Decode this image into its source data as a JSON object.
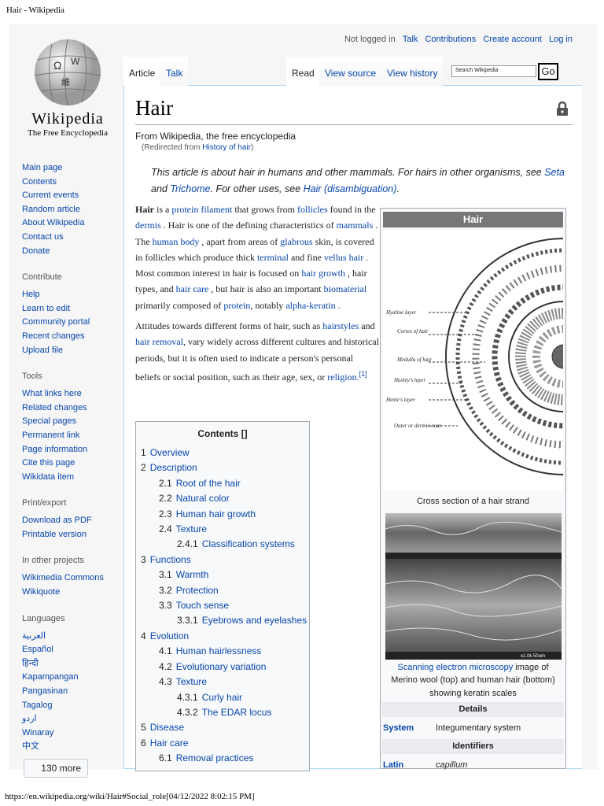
{
  "browser": {
    "doc_title": "Hair - Wikipedia",
    "footer_url": "https://en.wikipedia.org/wiki/Hair#Social_role[04/12/2022 8:02:15 PM]"
  },
  "logo": {
    "wordmark": "Wikipedia",
    "tagline": "The Free Encyclopedia"
  },
  "personal": {
    "not_logged": "Not logged in",
    "talk": "Talk",
    "contributions": "Contributions",
    "create": "Create account",
    "login": "Log in"
  },
  "tabs": {
    "article": "Article",
    "talk": "Talk",
    "read": "Read",
    "view_source": "View source",
    "history": "View history"
  },
  "search": {
    "placeholder": "Search Wikipedia",
    "go": "Go"
  },
  "sidebar": [
    {
      "heading": null,
      "items": [
        "Main page",
        "Contents",
        "Current events",
        "Random article",
        "About Wikipedia",
        "Contact us",
        "Donate"
      ]
    },
    {
      "heading": "Contribute",
      "items": [
        "Help",
        "Learn to edit",
        "Community portal",
        "Recent changes",
        "Upload file"
      ]
    },
    {
      "heading": "Tools",
      "items": [
        "What links here",
        "Related changes",
        "Special pages",
        "Permanent link",
        "Page information",
        "Cite this page",
        "Wikidata item"
      ]
    },
    {
      "heading": "Print/export",
      "items": [
        "Download as PDF",
        "Printable version"
      ]
    },
    {
      "heading": "In other projects",
      "items": [
        "Wikimedia Commons",
        "Wikiquote"
      ]
    },
    {
      "heading": "Languages",
      "items": [
        "العربية",
        "Español",
        "हिन्दी",
        "Kapampangan",
        "Pangasinan",
        "Tagalog",
        "اردو",
        "Winaray",
        "中文"
      ]
    }
  ],
  "languages_more": "130 more",
  "article": {
    "title": "Hair",
    "from": "From Wikipedia, the free encyclopedia",
    "redirected_prefix": "(Redirected from ",
    "redirected_link": "History of hair",
    "redirected_suffix": ")",
    "hatnote": [
      [
        "t",
        "This article is about hair in humans and other mammals. For hairs in other organisms, see "
      ],
      [
        "l",
        "Seta"
      ],
      [
        "t",
        " and "
      ],
      [
        "l",
        "Trichome"
      ],
      [
        "t",
        ". For other uses, see "
      ],
      [
        "l",
        "Hair (disambiguation)"
      ],
      [
        "t",
        "."
      ]
    ],
    "paragraphs": [
      [
        [
          "b",
          "Hair"
        ],
        [
          "t",
          " is a  "
        ],
        [
          "l",
          "protein filament"
        ],
        [
          "t",
          " that grows from "
        ],
        [
          "l",
          "follicles"
        ],
        [
          "t",
          " found in the "
        ],
        [
          "l",
          "dermis"
        ],
        [
          "t",
          " . Hair is one of the defining characteristics of "
        ],
        [
          "l",
          "mammals"
        ],
        [
          "t",
          " . The "
        ],
        [
          "l",
          "human body"
        ],
        [
          "t",
          " , apart from areas of "
        ],
        [
          "l",
          "glabrous"
        ],
        [
          "t",
          " skin, is covered in follicles which produce thick "
        ],
        [
          "l",
          "terminal"
        ],
        [
          "t",
          " and fine "
        ],
        [
          "l",
          "vellus hair"
        ],
        [
          "t",
          " . Most common interest in hair is focused on "
        ],
        [
          "l",
          "hair growth"
        ],
        [
          "t",
          " , hair types, and "
        ],
        [
          "l",
          "hair care"
        ],
        [
          "t",
          " , but hair is also an important "
        ],
        [
          "l",
          "biomaterial"
        ],
        [
          "t",
          "  primarily composed of "
        ],
        [
          "l",
          "protein"
        ],
        [
          "t",
          ", notably "
        ],
        [
          "l",
          "alpha-keratin"
        ],
        [
          "t",
          "  ."
        ]
      ],
      [
        [
          "t",
          "Attitudes towards different forms of hair, such as "
        ],
        [
          "l",
          "hairstyles"
        ],
        [
          "t",
          "  and  "
        ],
        [
          "l",
          "hair removal"
        ],
        [
          "t",
          ", vary widely across different cultures and historical periods, but it is often used to indicate a person's personal beliefs or social position, such as their age, sex, or "
        ],
        [
          "l",
          "religion"
        ],
        [
          "t",
          "."
        ],
        [
          "s",
          "[1]"
        ]
      ]
    ]
  },
  "toc": {
    "title": "Contents []",
    "items": [
      {
        "n": "1",
        "t": "Overview",
        "d": 0
      },
      {
        "n": "2",
        "t": "Description",
        "d": 0
      },
      {
        "n": "2.1",
        "t": "Root of the hair",
        "d": 1
      },
      {
        "n": "2.2",
        "t": "Natural color",
        "d": 1
      },
      {
        "n": "2.3",
        "t": "Human hair growth",
        "d": 1
      },
      {
        "n": "2.4",
        "t": "Texture",
        "d": 1
      },
      {
        "n": "2.4.1",
        "t": "Classification systems",
        "d": 2
      },
      {
        "n": "3",
        "t": "Functions",
        "d": 0
      },
      {
        "n": "3.1",
        "t": "Warmth",
        "d": 1
      },
      {
        "n": "3.2",
        "t": "Protection",
        "d": 1
      },
      {
        "n": "3.3",
        "t": "Touch sense",
        "d": 1
      },
      {
        "n": "3.3.1",
        "t": "Eyebrows and eyelashes",
        "d": 2
      },
      {
        "n": "4",
        "t": "Evolution",
        "d": 0
      },
      {
        "n": "4.1",
        "t": "Human hairlessness",
        "d": 1
      },
      {
        "n": "4.2",
        "t": "Evolutionary variation",
        "d": 1
      },
      {
        "n": "4.3",
        "t": "Texture",
        "d": 1
      },
      {
        "n": "4.3.1",
        "t": "Curly hair",
        "d": 2
      },
      {
        "n": "4.3.2",
        "t": "The EDAR locus",
        "d": 2
      },
      {
        "n": "5",
        "t": "Disease",
        "d": 0
      },
      {
        "n": "6",
        "t": "Hair care",
        "d": 0
      },
      {
        "n": "6.1",
        "t": "Removal practices",
        "d": 1
      }
    ]
  },
  "infobox": {
    "title": "Hair",
    "diagram_labels": [
      "Hyaline layer",
      "Cortex of hair",
      "Medulla of hair",
      "Huxley's layer",
      "Henle's layer",
      "Outer or dermic coat"
    ],
    "caption1": "Cross section of a hair strand",
    "sem_scale": "x1.0k  50um",
    "caption2_link": "Scanning electron microscopy",
    "caption2_text": " image of Merino wool (top) and human hair (bottom) showing keratin scales",
    "details": "Details",
    "system_label": "System",
    "system_value": "Integumentary system",
    "identifiers": "Identifiers",
    "latin_label": "Latin",
    "latin_value": "capillum"
  }
}
